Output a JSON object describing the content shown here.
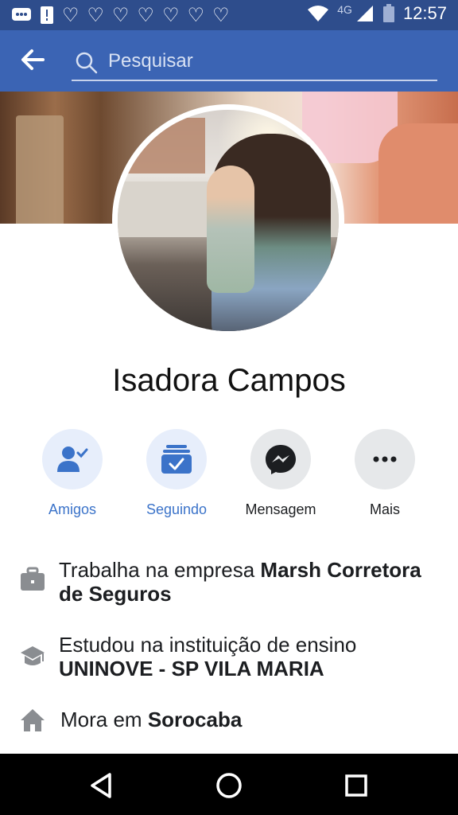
{
  "status_bar": {
    "network": "4G",
    "time": "12:57"
  },
  "app_bar": {
    "search_placeholder": "Pesquisar"
  },
  "profile": {
    "name": "Isadora Campos"
  },
  "actions": [
    {
      "label": "Amigos",
      "icon": "friends-check-icon",
      "style": "blue"
    },
    {
      "label": "Seguindo",
      "icon": "following-check-icon",
      "style": "blue"
    },
    {
      "label": "Mensagem",
      "icon": "messenger-icon",
      "style": "dark"
    },
    {
      "label": "Mais",
      "icon": "more-dots-icon",
      "style": "dark"
    }
  ],
  "info": {
    "work": {
      "prefix": "Trabalha na empresa ",
      "value": "Marsh Corretora de Seguros",
      "icon": "briefcase-icon"
    },
    "education": {
      "prefix": "Estudou na instituição de ensino ",
      "value": "UNINOVE - SP VILA MARIA",
      "icon": "graduation-cap-icon"
    },
    "home": {
      "prefix": "Mora em ",
      "value": "Sorocaba",
      "icon": "house-icon"
    }
  },
  "colors": {
    "status_bar": "#2e4d8c",
    "app_bar": "#3b64b4",
    "accent_blue": "#3b73c9",
    "text": "#1c1e21"
  }
}
